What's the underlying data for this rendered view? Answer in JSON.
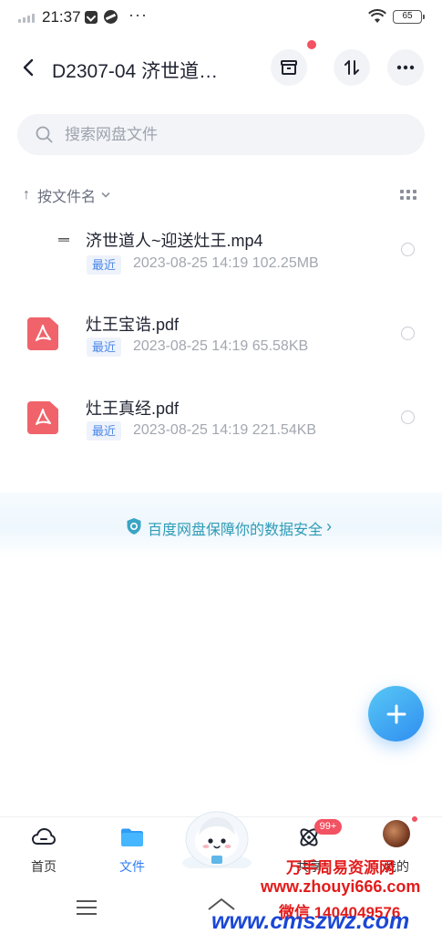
{
  "status_bar": {
    "time": "21:37",
    "more": "···",
    "battery": "65"
  },
  "header": {
    "title": "D2307-04 济世道…"
  },
  "search": {
    "placeholder": "搜索网盘文件"
  },
  "sort": {
    "label": "按文件名",
    "arrow": "↑"
  },
  "files": [
    {
      "name": "济世道人~迎送灶王.mp4",
      "badge": "最近",
      "meta": "2023-08-25  14:19  102.25MB",
      "type": "video"
    },
    {
      "name": "灶王宝诰.pdf",
      "badge": "最近",
      "meta": "2023-08-25  14:19  65.58KB",
      "type": "pdf"
    },
    {
      "name": "灶王真经.pdf",
      "badge": "最近",
      "meta": "2023-08-25  14:19  221.54KB",
      "type": "pdf"
    }
  ],
  "safety_banner": {
    "text": "百度网盘保障你的数据安全",
    "chevron": "›"
  },
  "bottom_nav": {
    "items": [
      {
        "label": "首页"
      },
      {
        "label": "文件"
      },
      {
        "label": "共享"
      },
      {
        "label": "我的"
      }
    ],
    "share_badge": "99+"
  },
  "watermark": {
    "line1": "万手周易资源网",
    "line2": "www.zhouyi666.com",
    "line3": "微信 1404049576",
    "line4": "www.cmszwz.com"
  },
  "colors": {
    "accent": "#2f7cf6",
    "pdf": "#f0636b",
    "alert": "#f25262",
    "safety": "#2e9bb6"
  }
}
